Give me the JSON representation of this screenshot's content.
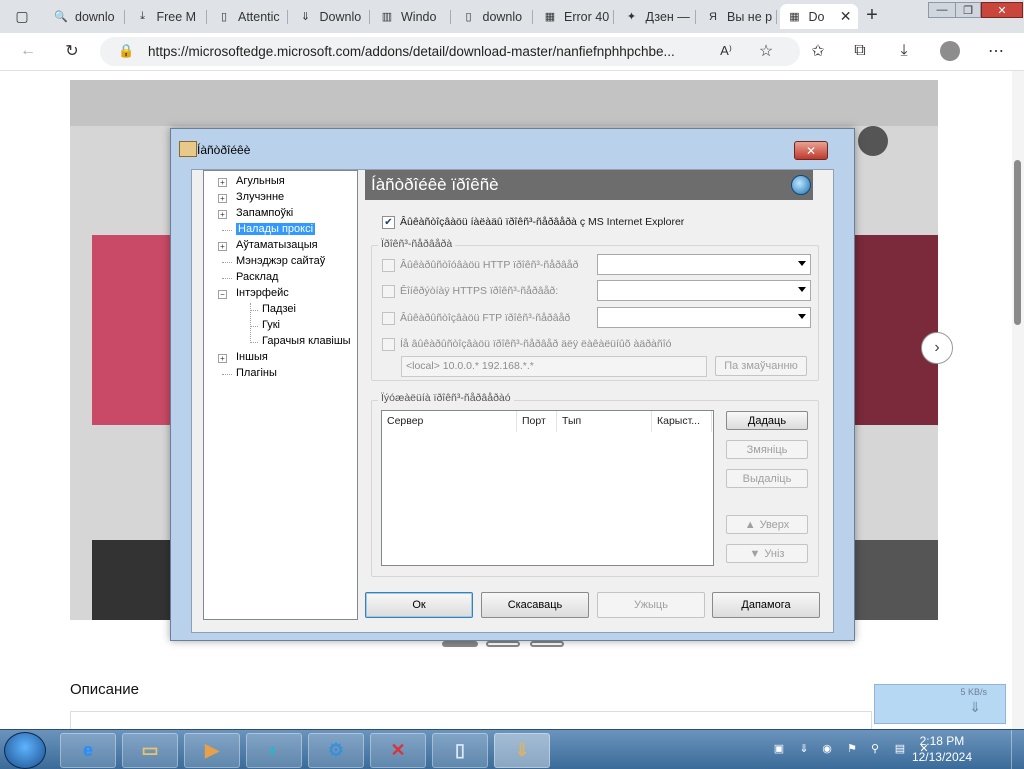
{
  "browser": {
    "tabs": [
      {
        "label": "downlo",
        "icon": "search-icon"
      },
      {
        "label": "Free M",
        "icon": "download-icon"
      },
      {
        "label": "Attentic",
        "icon": "document-icon"
      },
      {
        "label": "Downlo",
        "icon": "download-master-icon"
      },
      {
        "label": "Windo",
        "icon": "book-icon"
      },
      {
        "label": "downlo",
        "icon": "document-icon"
      },
      {
        "label": "Error 40",
        "icon": "microsoft-icon"
      },
      {
        "label": "Дзен —",
        "icon": "dzen-icon"
      },
      {
        "label": "Вы не р",
        "icon": "yandex-icon"
      },
      {
        "label": "Do",
        "icon": "microsoft-icon",
        "active": true
      }
    ],
    "new_tab": "+",
    "url": "https://microsoftedge.microsoft.com/addons/detail/download-master/nanfiefnphhpchbe...",
    "window_controls": {
      "minimize": "—",
      "restore": "❐",
      "close": "✕"
    }
  },
  "page": {
    "description_heading": "Описание",
    "notification_text": "5 KB/s"
  },
  "dialog": {
    "title": "Íàñòðîéêè",
    "close_label": "✕",
    "tree": [
      {
        "label": "Агульныя",
        "expand": "+",
        "level": 0
      },
      {
        "label": "Злучэнне",
        "expand": "+",
        "level": 0
      },
      {
        "label": "Запампоўкі",
        "expand": "+",
        "level": 0
      },
      {
        "label": "Налады проксі",
        "expand": "",
        "level": 0,
        "selected": true
      },
      {
        "label": "Аўтаматызацыя",
        "expand": "+",
        "level": 0
      },
      {
        "label": "Мэнэджэр сайтаў",
        "expand": "",
        "level": 0
      },
      {
        "label": "Расклад",
        "expand": "",
        "level": 0
      },
      {
        "label": "Інтэрфейс",
        "expand": "−",
        "level": 0
      },
      {
        "label": "Падзеі",
        "expand": "",
        "level": 1
      },
      {
        "label": "Гукі",
        "expand": "",
        "level": 1
      },
      {
        "label": "Гарачыя клавішы",
        "expand": "",
        "level": 1
      },
      {
        "label": "Іншыя",
        "expand": "+",
        "level": 0
      },
      {
        "label": "Плагіны",
        "expand": "",
        "level": 0
      }
    ],
    "panel_title": "Íàñòðîéêè ïðîêñè",
    "use_ie_proxy": "Âûêàñòîçâàöü íàëàäû ïðîêñ³-ñåðâåðà ç MS Internet Explorer",
    "proxy_group_label": "Ïðîêñ³-ñåðâåðà",
    "http_proxy": "Âûêàðûñòîóâàöü HTTP ïðîêñ³-ñåðâåð",
    "https_proxy": "Êîíêðýòíàÿ HTTPS ïðîêñ³-ñåðâåð:",
    "ftp_proxy": "Âûêàðûñòîçâàöü FTP ïðîêñ³-ñåðâåð",
    "bypass_label": "Íå âûêàðûñòîçâàöü ïðîêñ³-ñåðâåð äëÿ ëàêàëüíûõ àäðàñîó",
    "bypass_value": "<local> 10.0.0.* 192.168.*.*",
    "default_button": "Па змаўчанню",
    "list_group_label": "Ïýóæàëüíà ïðîêñ³-ñåðâåðàó",
    "columns": [
      "Сервер",
      "Порт",
      "Тып",
      "Карыст..."
    ],
    "side_buttons": [
      "Дадаць",
      "Змяніць",
      "Выдаліць",
      "Уверх",
      "Уніз"
    ],
    "bottom_buttons": [
      "Ок",
      "Скасаваць",
      "Ужыць",
      "Дапамога"
    ]
  },
  "taskbar": {
    "apps": [
      "ie-icon",
      "explorer-icon",
      "media-player-icon",
      "edge-icon",
      "gear-icon",
      "xmind-icon",
      "notepad-icon",
      "download-master-icon"
    ],
    "time": "2:18 PM",
    "date": "12/13/2024"
  }
}
